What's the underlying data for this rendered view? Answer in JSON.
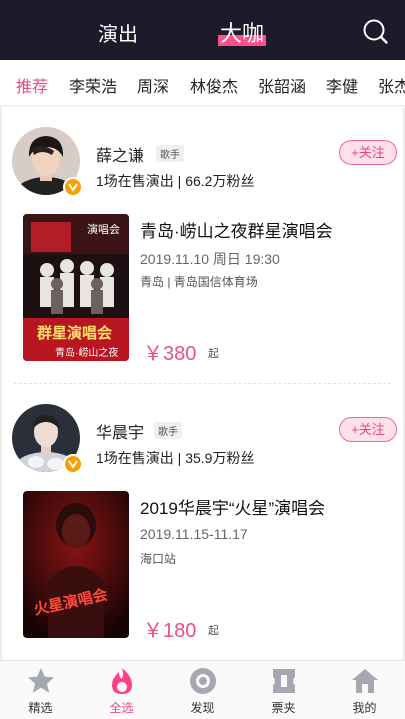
{
  "header": {
    "tabs": [
      {
        "label": "演出",
        "active": false
      },
      {
        "label": "大咖",
        "active": true
      }
    ],
    "search_icon": "search-icon",
    "accent_color": "#ff4f8b",
    "background_color": "#1c1a2b"
  },
  "categories": [
    "推荐",
    "李荣浩",
    "周深",
    "林俊杰",
    "张韶涵",
    "李健",
    "张杰"
  ],
  "active_category": "推荐",
  "artists": [
    {
      "name": "薛之谦",
      "role": "歌手",
      "stats": "1场在售演出 | 66.2万粉丝",
      "follow_label": "+关注",
      "show": {
        "poster_tag": "演唱会",
        "poster_text": "群星演唱会",
        "poster_subtext": "青岛·崂山之夜",
        "title": "青岛·崂山之夜群星演唱会",
        "date": "2019.11.10 周日 19:30",
        "venue": "青岛 | 青岛国信体育场",
        "price": "￥380",
        "price_suffix": "起"
      }
    },
    {
      "name": "华晨宇",
      "role": "歌手",
      "stats": "1场在售演出 | 35.9万粉丝",
      "follow_label": "+关注",
      "show": {
        "poster_text": "火星演唱会",
        "title": "2019华晨宇“火星”演唱会",
        "date": "2019.11.15-11.17",
        "venue": "海口站",
        "price": "￥180",
        "price_suffix": "起"
      }
    }
  ],
  "tabbar": [
    {
      "label": "精选",
      "icon": "star-icon",
      "active": false
    },
    {
      "label": "全选",
      "icon": "flame-icon",
      "active": true
    },
    {
      "label": "发现",
      "icon": "discover-icon",
      "active": false
    },
    {
      "label": "票夹",
      "icon": "ticket-icon",
      "active": false
    },
    {
      "label": "我的",
      "icon": "home-icon",
      "active": false
    }
  ],
  "price_color": "#ec4f86"
}
